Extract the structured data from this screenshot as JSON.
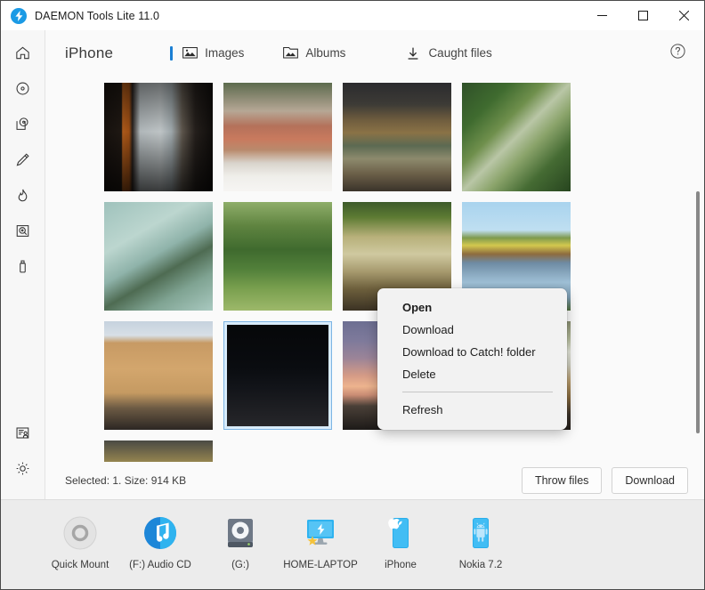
{
  "window": {
    "title": "DAEMON Tools Lite 11.0",
    "logo_icon": "daemon-lightning-icon",
    "minimize_label": "Minimize",
    "maximize_label": "Maximize",
    "close_label": "Close"
  },
  "rail": {
    "items": [
      {
        "name": "home",
        "icon": "home-icon"
      },
      {
        "name": "images",
        "icon": "disc-icon"
      },
      {
        "name": "mount",
        "icon": "disc-folder-icon"
      },
      {
        "name": "edit",
        "icon": "pencil-icon"
      },
      {
        "name": "burn",
        "icon": "flame-icon"
      },
      {
        "name": "catalog",
        "icon": "disc-drive-icon"
      },
      {
        "name": "usb",
        "icon": "usb-drive-icon"
      }
    ],
    "bottom_items": [
      {
        "name": "news",
        "icon": "news-person-icon"
      },
      {
        "name": "preferences",
        "icon": "gear-icon"
      }
    ]
  },
  "header": {
    "device_title": "iPhone",
    "tabs": [
      {
        "label": "Images",
        "icon": "image-icon",
        "active": true
      },
      {
        "label": "Albums",
        "icon": "album-icon",
        "active": false
      },
      {
        "label": "Caught files",
        "icon": "download-icon",
        "active": false
      }
    ],
    "help_icon": "help-circle-icon"
  },
  "gallery": {
    "thumbnails": [
      {
        "name": "window-plants-photo",
        "selected": false
      },
      {
        "name": "city-rooftops-photo",
        "selected": false
      },
      {
        "name": "art-gallery-photo",
        "selected": false
      },
      {
        "name": "greenhouse-photo",
        "selected": false
      },
      {
        "name": "palm-leaves-photo",
        "selected": false
      },
      {
        "name": "park-trees-photo",
        "selected": false
      },
      {
        "name": "dune-grass-photo",
        "selected": false
      },
      {
        "name": "lake-field-photo",
        "selected": false
      },
      {
        "name": "game-controllers-desk-photo",
        "selected": false
      },
      {
        "name": "night-street-photo",
        "selected": true
      },
      {
        "name": "sunset-sky-photo",
        "selected": false
      },
      {
        "name": "camera-controllers-photo",
        "selected": false
      },
      {
        "name": "autumn-building-photo",
        "selected": false
      }
    ]
  },
  "status": {
    "text": "Selected: 1. Size: 914 KB",
    "throw_files_label": "Throw files",
    "download_label": "Download"
  },
  "context_menu": {
    "items": [
      {
        "label": "Open",
        "bold": true
      },
      {
        "label": "Download",
        "bold": false
      },
      {
        "label": "Download to Catch! folder",
        "bold": false
      },
      {
        "label": "Delete",
        "bold": false
      }
    ],
    "after_separator": [
      {
        "label": "Refresh",
        "bold": false
      }
    ]
  },
  "dock": {
    "items": [
      {
        "label": "Quick Mount",
        "icon": "quick-mount-icon"
      },
      {
        "label": "(F:) Audio CD",
        "icon": "audio-cd-icon"
      },
      {
        "label": "(G:)",
        "icon": "disc-drive-icon"
      },
      {
        "label": "HOME-LAPTOP",
        "icon": "computer-star-icon"
      },
      {
        "label": "iPhone",
        "icon": "apple-phone-icon"
      },
      {
        "label": "Nokia 7.2",
        "icon": "android-phone-icon"
      }
    ]
  },
  "colors": {
    "accent": "#1b7fd4",
    "brand": "#1b9ae5",
    "selection_border": "#7db5e4",
    "selection_fill": "#d9ecfb"
  }
}
